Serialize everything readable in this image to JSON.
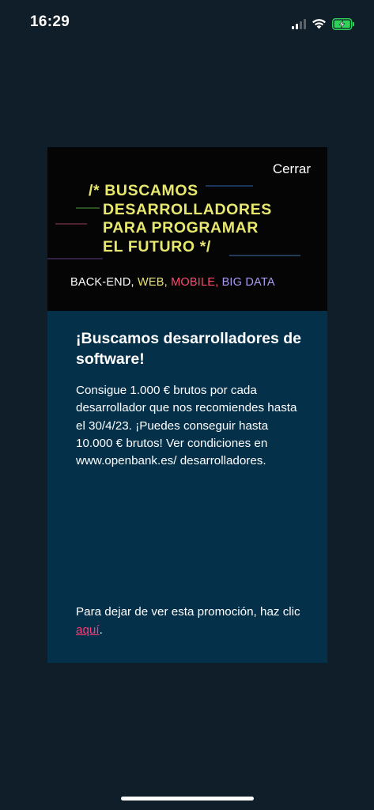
{
  "status_bar": {
    "time": "16:29",
    "icons": [
      "cellular-signal-icon",
      "wifi-icon",
      "battery-charging-icon"
    ],
    "battery_color": "#30d158"
  },
  "promo": {
    "close_label": "Cerrar",
    "headline_lines": [
      "/* BUSCAMOS",
      "   DESARROLLADORES",
      "   PARA PROGRAMAR",
      "   EL FUTURO */"
    ],
    "tech": {
      "backend": "BACK-END,",
      "web": "WEB,",
      "mobile": "MOBILE,",
      "bigdata": "BIG DATA"
    },
    "title": "¡Buscamos desarrolladores de software!",
    "body": "Consigue 1.000 € brutos por cada desarrollador que nos recomiendes hasta el 30/4/23. ¡Puedes conseguir hasta 10.000 € brutos! Ver condiciones en www.openbank.es/ desarrolladores.",
    "footer_text": "Para dejar de ver esta promoción, haz clic",
    "optout_link": "aquí",
    "footer_end": "."
  },
  "colors": {
    "page_background": "#0f1e28",
    "modal_background": "#04304a",
    "banner_background": "#050505",
    "headline": "#e8e86e",
    "web": "#eae66d",
    "mobile": "#ff4a73",
    "bigdata": "#a89bf0",
    "link": "#ff3b77"
  }
}
